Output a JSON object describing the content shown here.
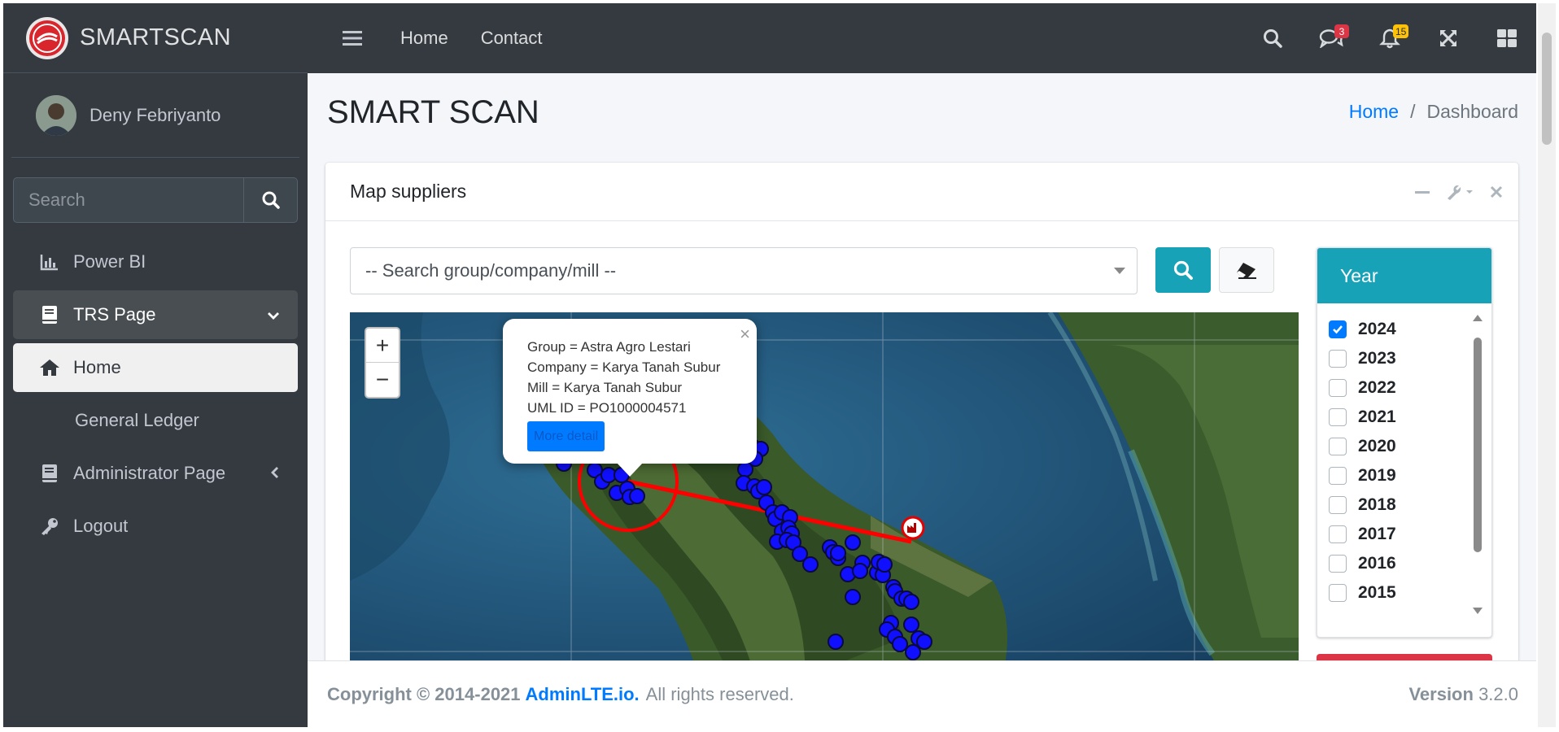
{
  "brand": {
    "name": "SMARTSCAN"
  },
  "user": {
    "name": "Deny Febriyanto"
  },
  "sidebar": {
    "search_placeholder": "Search",
    "items": [
      {
        "label": "Power BI",
        "icon": "chart-bar-icon"
      },
      {
        "label": "TRS Page",
        "icon": "book-icon"
      },
      {
        "label": "Home",
        "icon": "home-icon"
      },
      {
        "label": "General Ledger",
        "icon": ""
      },
      {
        "label": "Administrator Page",
        "icon": "book-icon"
      },
      {
        "label": "Logout",
        "icon": "key-icon"
      }
    ]
  },
  "topbar": {
    "links": [
      "Home",
      "Contact"
    ],
    "messages_count": "3",
    "notifications_count": "15"
  },
  "page": {
    "title": "SMART SCAN",
    "breadcrumb": [
      "Home",
      "Dashboard"
    ]
  },
  "card": {
    "title": "Map suppliers",
    "search_placeholder": "-- Search group/company/mill --"
  },
  "popup": {
    "group": "Group = Astra Agro Lestari",
    "company": "Company = Karya Tanah Subur",
    "mill": "Mill = Karya Tanah Subur",
    "uml": "UML ID = PO1000004571",
    "button": "More detail"
  },
  "year_filter": {
    "title": "Year",
    "years": [
      {
        "label": "2024",
        "checked": true
      },
      {
        "label": "2023",
        "checked": false
      },
      {
        "label": "2022",
        "checked": false
      },
      {
        "label": "2021",
        "checked": false
      },
      {
        "label": "2020",
        "checked": false
      },
      {
        "label": "2019",
        "checked": false
      },
      {
        "label": "2018",
        "checked": false
      },
      {
        "label": "2017",
        "checked": false
      },
      {
        "label": "2016",
        "checked": false
      },
      {
        "label": "2015",
        "checked": false
      }
    ]
  },
  "footer": {
    "copyright": "Copyright © 2014-2021",
    "link": "AdminLTE.io.",
    "rights": "All rights reserved.",
    "version_label": "Version",
    "version": "3.2.0"
  },
  "colors": {
    "sidebar": "#343a40",
    "accent": "#17a2b8",
    "link": "#007bff",
    "marker": "#1010ff",
    "route": "#ff0000"
  }
}
